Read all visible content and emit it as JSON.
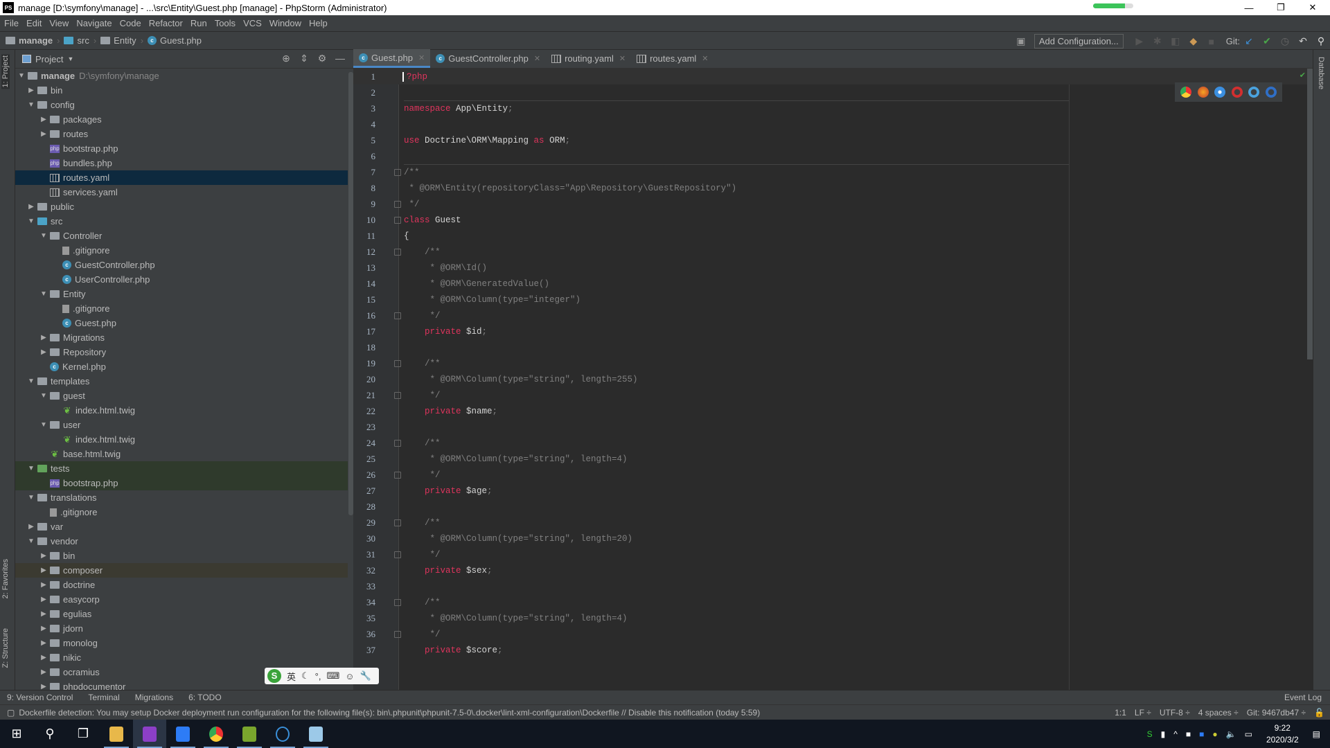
{
  "window": {
    "title": "manage [D:\\symfony\\manage] - ...\\src\\Entity\\Guest.php [manage] - PhpStorm (Administrator)",
    "app_icon": "PS",
    "progress": 0.8
  },
  "menu": [
    "File",
    "Edit",
    "View",
    "Navigate",
    "Code",
    "Refactor",
    "Run",
    "Tools",
    "VCS",
    "Window",
    "Help"
  ],
  "breadcrumb": [
    {
      "label": "manage",
      "icon": "folder"
    },
    {
      "label": "src",
      "icon": "folder-blue"
    },
    {
      "label": "Entity",
      "icon": "folder"
    },
    {
      "label": "Guest.php",
      "icon": "php-class"
    }
  ],
  "toolbar": {
    "add_configuration": "Add Configuration...",
    "git_label": "Git:"
  },
  "side_tabs": {
    "project": "1: Project",
    "favorites": "2: Favorites",
    "structure": "Z: Structure",
    "database": "Database"
  },
  "project": {
    "title": "Project",
    "tree": [
      {
        "d": 0,
        "t": "folder",
        "e": "open",
        "label": "manage",
        "hint": "D:\\symfony\\manage",
        "bold": true
      },
      {
        "d": 1,
        "t": "folder",
        "e": "closed",
        "label": "bin"
      },
      {
        "d": 1,
        "t": "folder",
        "e": "open",
        "label": "config"
      },
      {
        "d": 2,
        "t": "folder",
        "e": "closed",
        "label": "packages"
      },
      {
        "d": 2,
        "t": "folder",
        "e": "closed",
        "label": "routes"
      },
      {
        "d": 2,
        "t": "php",
        "label": "bootstrap.php"
      },
      {
        "d": 2,
        "t": "php",
        "label": "bundles.php"
      },
      {
        "d": 2,
        "t": "yaml",
        "label": "routes.yaml",
        "state": "selected"
      },
      {
        "d": 2,
        "t": "yaml",
        "label": "services.yaml"
      },
      {
        "d": 1,
        "t": "folder",
        "e": "closed",
        "label": "public"
      },
      {
        "d": 1,
        "t": "folder-blue",
        "e": "open",
        "label": "src"
      },
      {
        "d": 2,
        "t": "folder",
        "e": "open",
        "label": "Controller"
      },
      {
        "d": 3,
        "t": "git",
        "label": ".gitignore"
      },
      {
        "d": 3,
        "t": "class",
        "label": "GuestController.php"
      },
      {
        "d": 3,
        "t": "class",
        "label": "UserController.php"
      },
      {
        "d": 2,
        "t": "folder",
        "e": "open",
        "label": "Entity"
      },
      {
        "d": 3,
        "t": "git",
        "label": ".gitignore"
      },
      {
        "d": 3,
        "t": "class",
        "label": "Guest.php"
      },
      {
        "d": 2,
        "t": "folder",
        "e": "closed",
        "label": "Migrations"
      },
      {
        "d": 2,
        "t": "folder",
        "e": "closed",
        "label": "Repository"
      },
      {
        "d": 2,
        "t": "class",
        "label": "Kernel.php"
      },
      {
        "d": 1,
        "t": "folder",
        "e": "open",
        "label": "templates"
      },
      {
        "d": 2,
        "t": "folder",
        "e": "open",
        "label": "guest"
      },
      {
        "d": 3,
        "t": "twig",
        "label": "index.html.twig"
      },
      {
        "d": 2,
        "t": "folder",
        "e": "open",
        "label": "user"
      },
      {
        "d": 3,
        "t": "twig",
        "label": "index.html.twig"
      },
      {
        "d": 2,
        "t": "twig",
        "label": "base.html.twig"
      },
      {
        "d": 1,
        "t": "folder-green",
        "e": "open",
        "label": "tests",
        "state": "tests"
      },
      {
        "d": 2,
        "t": "php",
        "label": "bootstrap.php",
        "state": "tests"
      },
      {
        "d": 1,
        "t": "folder",
        "e": "open",
        "label": "translations"
      },
      {
        "d": 2,
        "t": "git",
        "label": ".gitignore"
      },
      {
        "d": 1,
        "t": "folder",
        "e": "closed",
        "label": "var"
      },
      {
        "d": 1,
        "t": "folder",
        "e": "open",
        "label": "vendor"
      },
      {
        "d": 2,
        "t": "folder",
        "e": "closed",
        "label": "bin"
      },
      {
        "d": 2,
        "t": "folder",
        "e": "closed",
        "label": "composer",
        "state": "comp"
      },
      {
        "d": 2,
        "t": "folder",
        "e": "closed",
        "label": "doctrine"
      },
      {
        "d": 2,
        "t": "folder",
        "e": "closed",
        "label": "easycorp"
      },
      {
        "d": 2,
        "t": "folder",
        "e": "closed",
        "label": "egulias"
      },
      {
        "d": 2,
        "t": "folder",
        "e": "closed",
        "label": "jdorn"
      },
      {
        "d": 2,
        "t": "folder",
        "e": "closed",
        "label": "monolog"
      },
      {
        "d": 2,
        "t": "folder",
        "e": "closed",
        "label": "nikic"
      },
      {
        "d": 2,
        "t": "folder",
        "e": "closed",
        "label": "ocramius"
      },
      {
        "d": 2,
        "t": "folder",
        "e": "closed",
        "label": "phpdocumentor"
      }
    ]
  },
  "tabs": [
    {
      "label": "Guest.php",
      "icon": "php-class",
      "active": true
    },
    {
      "label": "GuestController.php",
      "icon": "php-class"
    },
    {
      "label": "routing.yaml",
      "icon": "yaml"
    },
    {
      "label": "routes.yaml",
      "icon": "yaml"
    }
  ],
  "browsers": [
    "chrome",
    "firefox",
    "safari",
    "opera",
    "ie",
    "edge"
  ],
  "code": [
    [
      [
        "?php",
        "ph"
      ]
    ],
    [],
    [
      [
        "namespace",
        "kw"
      ],
      [
        " App\\Entity",
        ""
      ],
      [
        ";",
        "cm"
      ]
    ],
    [],
    [
      [
        "use",
        "kw"
      ],
      [
        " Doctrine\\ORM\\Mapping ",
        ""
      ],
      [
        "as",
        "kw"
      ],
      [
        " ORM",
        ""
      ],
      [
        ";",
        "cm"
      ]
    ],
    [],
    [
      [
        "/**",
        "cm"
      ]
    ],
    [
      [
        " * @ORM\\Entity(repositoryClass=\"App\\Repository\\GuestRepository\")",
        "cm"
      ]
    ],
    [
      [
        " */",
        "cm"
      ]
    ],
    [
      [
        "class",
        "kw"
      ],
      [
        " Guest",
        ""
      ]
    ],
    [
      [
        "{",
        ""
      ]
    ],
    [
      [
        "    /**",
        "cm"
      ]
    ],
    [
      [
        "     * @ORM\\Id()",
        "cm"
      ]
    ],
    [
      [
        "     * @ORM\\GeneratedValue()",
        "cm"
      ]
    ],
    [
      [
        "     * @ORM\\Column(type=\"integer\")",
        "cm"
      ]
    ],
    [
      [
        "     */",
        "cm"
      ]
    ],
    [
      [
        "    private",
        "kw"
      ],
      [
        " $id",
        ""
      ],
      [
        ";",
        "cm"
      ]
    ],
    [],
    [
      [
        "    /**",
        "cm"
      ]
    ],
    [
      [
        "     * @ORM\\Column(type=\"string\", length=255)",
        "cm"
      ]
    ],
    [
      [
        "     */",
        "cm"
      ]
    ],
    [
      [
        "    private",
        "kw"
      ],
      [
        " $name",
        ""
      ],
      [
        ";",
        "cm"
      ]
    ],
    [],
    [
      [
        "    /**",
        "cm"
      ]
    ],
    [
      [
        "     * @ORM\\Column(type=\"string\", length=4)",
        "cm"
      ]
    ],
    [
      [
        "     */",
        "cm"
      ]
    ],
    [
      [
        "    private",
        "kw"
      ],
      [
        " $age",
        ""
      ],
      [
        ";",
        "cm"
      ]
    ],
    [],
    [
      [
        "    /**",
        "cm"
      ]
    ],
    [
      [
        "     * @ORM\\Column(type=\"string\", length=20)",
        "cm"
      ]
    ],
    [
      [
        "     */",
        "cm"
      ]
    ],
    [
      [
        "    private",
        "kw"
      ],
      [
        " $sex",
        ""
      ],
      [
        ";",
        "cm"
      ]
    ],
    [],
    [
      [
        "    /**",
        "cm"
      ]
    ],
    [
      [
        "     * @ORM\\Column(type=\"string\", length=4)",
        "cm"
      ]
    ],
    [
      [
        "     */",
        "cm"
      ]
    ],
    [
      [
        "    private",
        "kw"
      ],
      [
        " $score",
        ""
      ],
      [
        ";",
        "cm"
      ]
    ]
  ],
  "bottom_tools": [
    "9: Version Control",
    "Terminal",
    "Migrations",
    "6: TODO"
  ],
  "event_log": "Event Log",
  "status": {
    "message": "Dockerfile detection: You may setup Docker deployment run configuration for the following file(s): bin\\.phpunit\\phpunit-7.5-0\\.docker\\lint-xml-configuration\\Dockerfile // Disable this notification (today 5:59)",
    "position": "1:1",
    "line_sep": "LF ÷",
    "encoding": "UTF-8 ÷",
    "indent": "4 spaces ÷",
    "git": "Git: 9467db47 ÷"
  },
  "ime": {
    "lang": "英"
  },
  "clock": {
    "time": "9:22",
    "date": "2020/3/2"
  },
  "colors": {
    "keyword": "#e0345d",
    "comment": "#808080",
    "selection": "#0d293e",
    "accent": "#4a88c7"
  }
}
